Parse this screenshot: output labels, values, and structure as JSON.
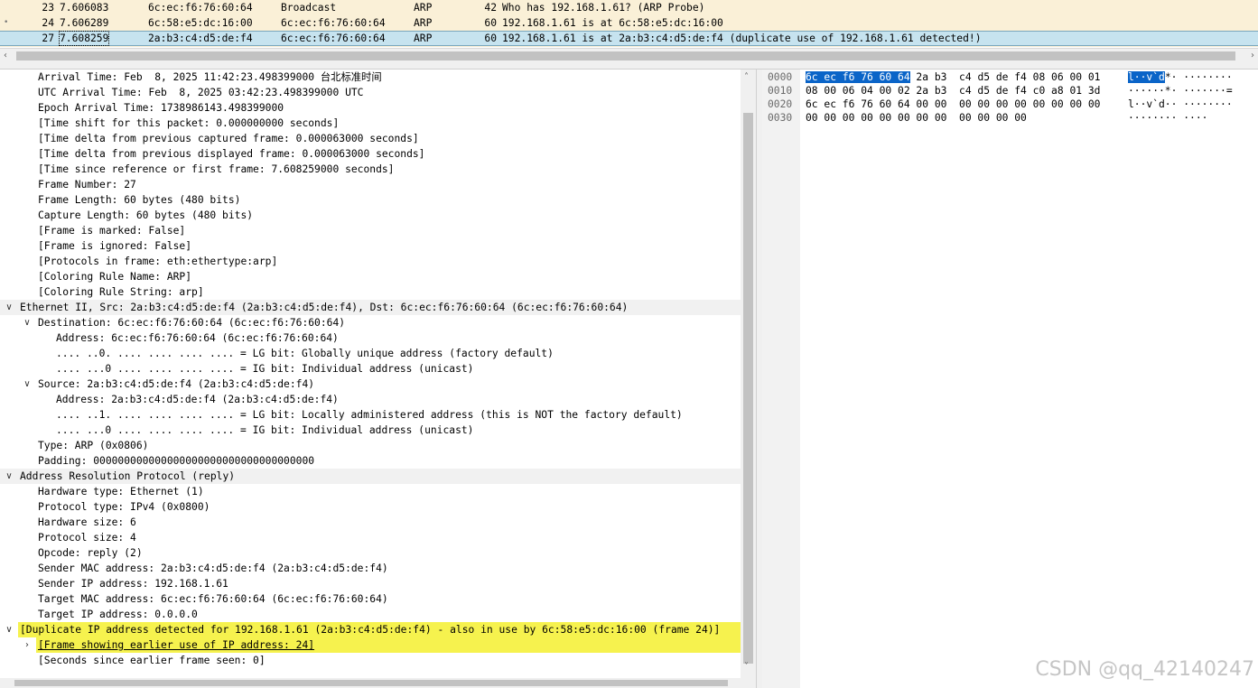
{
  "packet_list": {
    "rows": [
      {
        "no": "23",
        "time": "7.606083",
        "source": "6c:ec:f6:76:60:64",
        "destination": "Broadcast",
        "protocol": "ARP",
        "length": "42",
        "info": "Who has 192.168.1.61? (ARP Probe)"
      },
      {
        "no": "24",
        "time": "7.606289",
        "source": "6c:58:e5:dc:16:00",
        "destination": "6c:ec:f6:76:60:64",
        "protocol": "ARP",
        "length": "60",
        "info": "192.168.1.61 is at 6c:58:e5:dc:16:00",
        "marker": "•"
      },
      {
        "no": "27",
        "time": "7.608259",
        "source": "2a:b3:c4:d5:de:f4",
        "destination": "6c:ec:f6:76:60:64",
        "protocol": "ARP",
        "length": "60",
        "info": "192.168.1.61 is at 2a:b3:c4:d5:de:f4 (duplicate use of 192.168.1.61 detected!)"
      }
    ],
    "selected_index": 2,
    "row_bg": "#faf0d7",
    "selected_bg": "#c6e3ef"
  },
  "details": {
    "lines": [
      {
        "text": "Arrival Time: Feb  8, 2025 11:42:23.498399000 台北标准时间",
        "indent": 2
      },
      {
        "text": "UTC Arrival Time: Feb  8, 2025 03:42:23.498399000 UTC",
        "indent": 2
      },
      {
        "text": "Epoch Arrival Time: 1738986143.498399000",
        "indent": 2
      },
      {
        "text": "[Time shift for this packet: 0.000000000 seconds]",
        "indent": 2
      },
      {
        "text": "[Time delta from previous captured frame: 0.000063000 seconds]",
        "indent": 2
      },
      {
        "text": "[Time delta from previous displayed frame: 0.000063000 seconds]",
        "indent": 2
      },
      {
        "text": "[Time since reference or first frame: 7.608259000 seconds]",
        "indent": 2
      },
      {
        "text": "Frame Number: 27",
        "indent": 2
      },
      {
        "text": "Frame Length: 60 bytes (480 bits)",
        "indent": 2
      },
      {
        "text": "Capture Length: 60 bytes (480 bits)",
        "indent": 2
      },
      {
        "text": "[Frame is marked: False]",
        "indent": 2
      },
      {
        "text": "[Frame is ignored: False]",
        "indent": 2
      },
      {
        "text": "[Protocols in frame: eth:ethertype:arp]",
        "indent": 2
      },
      {
        "text": "[Coloring Rule Name: ARP]",
        "indent": 2
      },
      {
        "text": "[Coloring Rule String: arp]",
        "indent": 2
      },
      {
        "text": "Ethernet II, Src: 2a:b3:c4:d5:de:f4 (2a:b3:c4:d5:de:f4), Dst: 6c:ec:f6:76:60:64 (6c:ec:f6:76:60:64)",
        "indent": 1,
        "toggle": "v",
        "style": "header"
      },
      {
        "text": "Destination: 6c:ec:f6:76:60:64 (6c:ec:f6:76:60:64)",
        "indent": 2,
        "toggle": "v"
      },
      {
        "text": "Address: 6c:ec:f6:76:60:64 (6c:ec:f6:76:60:64)",
        "indent": 3
      },
      {
        "text": ".... ..0. .... .... .... .... = LG bit: Globally unique address (factory default)",
        "indent": 3
      },
      {
        "text": ".... ...0 .... .... .... .... = IG bit: Individual address (unicast)",
        "indent": 3
      },
      {
        "text": "Source: 2a:b3:c4:d5:de:f4 (2a:b3:c4:d5:de:f4)",
        "indent": 2,
        "toggle": "v"
      },
      {
        "text": "Address: 2a:b3:c4:d5:de:f4 (2a:b3:c4:d5:de:f4)",
        "indent": 3
      },
      {
        "text": ".... ..1. .... .... .... .... = LG bit: Locally administered address (this is NOT the factory default)",
        "indent": 3
      },
      {
        "text": ".... ...0 .... .... .... .... = IG bit: Individual address (unicast)",
        "indent": 3
      },
      {
        "text": "Type: ARP (0x0806)",
        "indent": 2
      },
      {
        "text": "Padding: 000000000000000000000000000000000000",
        "indent": 2
      },
      {
        "text": "Address Resolution Protocol (reply)",
        "indent": 1,
        "toggle": "v",
        "style": "header"
      },
      {
        "text": "Hardware type: Ethernet (1)",
        "indent": 2
      },
      {
        "text": "Protocol type: IPv4 (0x0800)",
        "indent": 2
      },
      {
        "text": "Hardware size: 6",
        "indent": 2
      },
      {
        "text": "Protocol size: 4",
        "indent": 2
      },
      {
        "text": "Opcode: reply (2)",
        "indent": 2
      },
      {
        "text": "Sender MAC address: 2a:b3:c4:d5:de:f4 (2a:b3:c4:d5:de:f4)",
        "indent": 2
      },
      {
        "text": "Sender IP address: 192.168.1.61",
        "indent": 2
      },
      {
        "text": "Target MAC address: 6c:ec:f6:76:60:64 (6c:ec:f6:76:60:64)",
        "indent": 2
      },
      {
        "text": "Target IP address: 0.0.0.0",
        "indent": 2
      },
      {
        "text": "[Duplicate IP address detected for 192.168.1.61 (2a:b3:c4:d5:de:f4) - also in use by 6c:58:e5:dc:16:00 (frame 24)]",
        "indent": 1,
        "toggle": "v",
        "style": "warn"
      },
      {
        "text": "[Frame showing earlier use of IP address: 24]",
        "indent": 2,
        "toggle": ">",
        "style": "warn",
        "link": true
      },
      {
        "text": "[Seconds since earlier frame seen: 0]",
        "indent": 2
      }
    ],
    "warn_bg": "#f6f24e",
    "header_bg": "#f1f1f1"
  },
  "bytes": {
    "rows": [
      {
        "offset": "0000",
        "hex_sel": "6c ec f6 76 60 64",
        "hex_rest": " 2a b3  c4 d5 de f4 08 06 00 01",
        "ascii_sel": "l··v`d",
        "ascii_rest": "*· ········"
      },
      {
        "offset": "0010",
        "hex_sel": "",
        "hex_rest": "08 00 06 04 00 02 2a b3  c4 d5 de f4 c0 a8 01 3d",
        "ascii_sel": "",
        "ascii_rest": "······*· ·······="
      },
      {
        "offset": "0020",
        "hex_sel": "",
        "hex_rest": "6c ec f6 76 60 64 00 00  00 00 00 00 00 00 00 00",
        "ascii_sel": "",
        "ascii_rest": "l··v`d·· ········"
      },
      {
        "offset": "0030",
        "hex_sel": "",
        "hex_rest": "00 00 00 00 00 00 00 00  00 00 00 00",
        "ascii_sel": "",
        "ascii_rest": "········ ····"
      }
    ],
    "highlight_color": "#0a64c8"
  },
  "watermark": "CSDN @qq_42140247"
}
